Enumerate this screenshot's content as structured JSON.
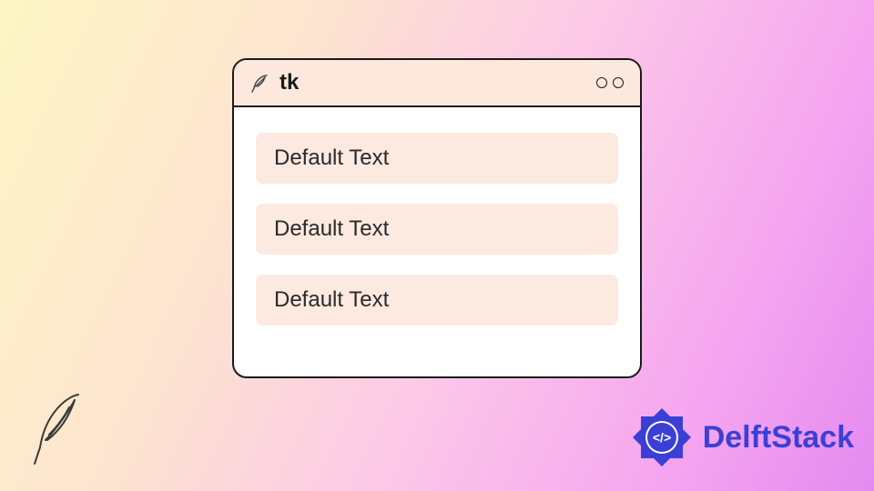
{
  "window": {
    "title": "tk",
    "title_icon": "feather-icon",
    "inputs": [
      {
        "value": "Default Text"
      },
      {
        "value": "Default Text"
      },
      {
        "value": "Default Text"
      }
    ]
  },
  "decoration": {
    "bottom_icon": "feather-icon"
  },
  "brand": {
    "name": "DelftStack",
    "logo": "delftstack-logo",
    "color": "#3b3fd6"
  }
}
